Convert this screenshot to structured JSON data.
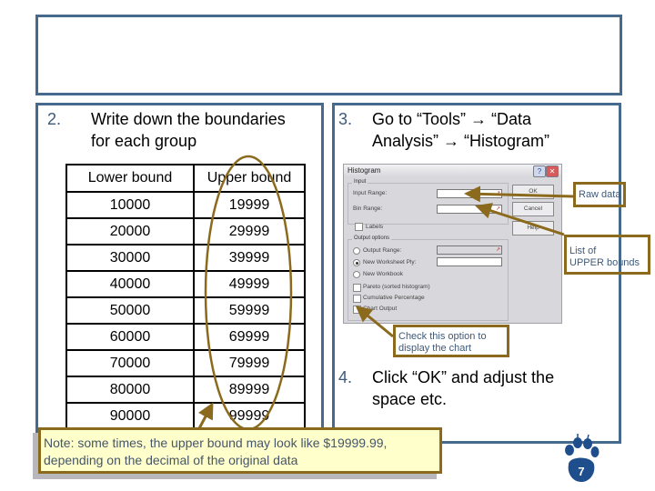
{
  "title_box": {
    "text": ""
  },
  "step2": {
    "number": "2.",
    "text_line1": "Write down the boundaries",
    "text_line2": "for each group"
  },
  "bounds_table": {
    "headers": [
      "Lower bound",
      "Upper bound"
    ],
    "rows": [
      [
        "10000",
        "19999"
      ],
      [
        "20000",
        "29999"
      ],
      [
        "30000",
        "39999"
      ],
      [
        "40000",
        "49999"
      ],
      [
        "50000",
        "59999"
      ],
      [
        "60000",
        "69999"
      ],
      [
        "70000",
        "79999"
      ],
      [
        "80000",
        "89999"
      ],
      [
        "90000",
        "99999"
      ]
    ]
  },
  "step3": {
    "number": "3.",
    "text_line1": "Go to “Tools” → “Data",
    "text_line2": "Analysis” → “Histogram”"
  },
  "dialog": {
    "title": "Histogram",
    "help_glyph": "?",
    "close_glyph": "✕",
    "input_group": "Input",
    "input_range_label": "Input Range:",
    "bin_range_label": "Bin Range:",
    "input_range_value": "",
    "bin_range_value": "",
    "labels_checkbox": "Labels",
    "output_group": "Output options",
    "output_range_option": "Output Range:",
    "new_ply_option": "New Worksheet Ply:",
    "new_workbook_option": "New Workbook",
    "selected_output": "New Worksheet Ply:",
    "pareto_checkbox": "Pareto (sorted histogram)",
    "cumulative_checkbox": "Cumulative Percentage",
    "chart_output_checkbox": "Chart Output",
    "ok_button": "OK",
    "cancel_button": "Cancel",
    "help_button": "Help",
    "ref_icon": "↗"
  },
  "callouts": {
    "raw_data": "Raw data",
    "upper_bounds_line1": "List of",
    "upper_bounds_line2": "UPPER bounds",
    "chart_line1": "Check this option to",
    "chart_line2": "display the chart"
  },
  "step4": {
    "number": "4.",
    "text_line1": "Click “OK” and adjust the",
    "text_line2": "space etc."
  },
  "note": {
    "line1": "Note: some times, the upper bound may look like $19999.99,",
    "line2": "depending on the decimal of the original data"
  },
  "page_number": "7",
  "colors": {
    "frame_blue": "#466a8e",
    "annotation_brown": "#8b6a1e",
    "note_fill": "#ffffcc",
    "paw_blue": "#1f4e8c"
  }
}
